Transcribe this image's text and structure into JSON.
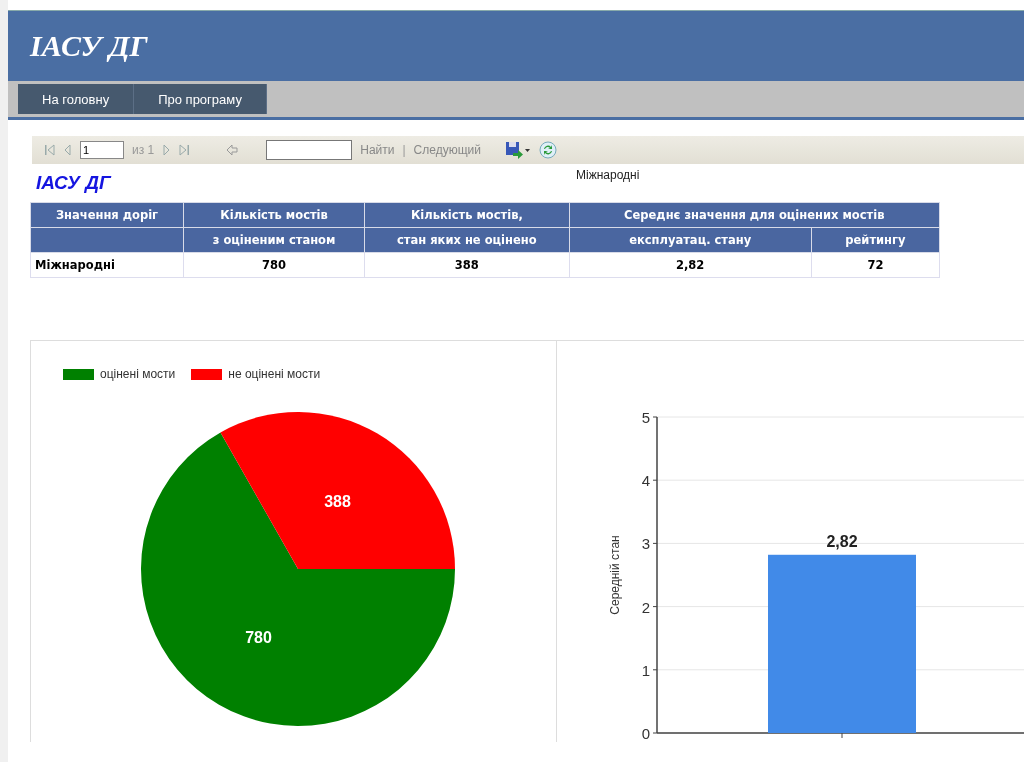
{
  "header": {
    "title": "ІАСУ ДГ"
  },
  "nav": {
    "items": [
      {
        "label": "На головну"
      },
      {
        "label": "Про програму"
      }
    ]
  },
  "toolbar": {
    "page": "1",
    "page_count": "из 1",
    "find_link": "Найти",
    "separator": "|",
    "next_link": "Следующий"
  },
  "report": {
    "title": "ІАСУ ДГ",
    "subtitle": "Міжнародні"
  },
  "table": {
    "header_rows": [
      [
        "Значення доріг",
        "Кількість мостів",
        "Кількість мостів,",
        "Середнє значення для оцінених мостів"
      ],
      [
        "з оціненим станом",
        "стан яких не оцінено",
        "експлуатац. стану",
        "рейтингу"
      ]
    ],
    "rows": [
      [
        "Міжнародні",
        "780",
        "388",
        "2,82",
        "72"
      ]
    ]
  },
  "pie": {
    "chart_data": {
      "type": "pie",
      "data_labels": true,
      "legend": "top",
      "categories": [
        "оцінені мости",
        "не оцінені мости"
      ],
      "colors": [
        "#008000",
        "#ff0000"
      ],
      "values": [
        780,
        388
      ]
    }
  },
  "bar": {
    "chart_data": {
      "type": "bar",
      "ylabel": "Середній стан",
      "ylim": [
        0,
        5
      ],
      "yticks": [
        0,
        1,
        2,
        3,
        4,
        5
      ],
      "grid": true,
      "value_labels": [
        "2,82"
      ],
      "series": [
        {
          "color": "#418ae8",
          "values": [
            2.82
          ]
        }
      ]
    }
  }
}
